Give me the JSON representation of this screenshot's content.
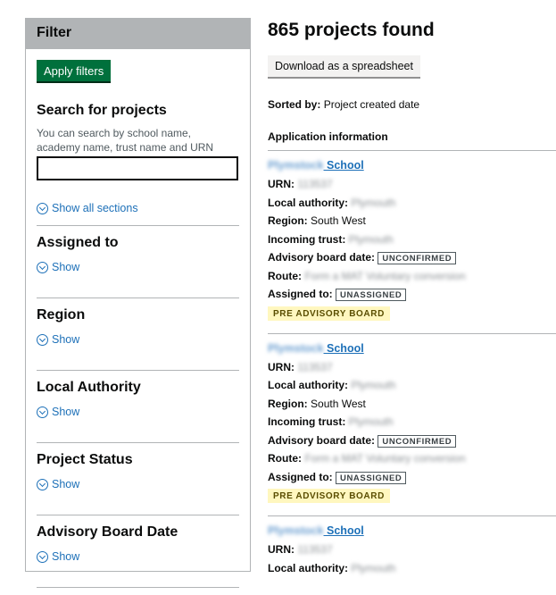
{
  "filter": {
    "header": "Filter",
    "apply_label": "Apply filters",
    "search_title": "Search for projects",
    "search_hint": "You can search by school name, academy name, trust name and URN",
    "search_value": "",
    "show_all_label": "Show all sections",
    "sections": [
      {
        "title": "Assigned to",
        "show_label": "Show"
      },
      {
        "title": "Region",
        "show_label": "Show"
      },
      {
        "title": "Local Authority",
        "show_label": "Show"
      },
      {
        "title": "Project Status",
        "show_label": "Show"
      },
      {
        "title": "Advisory Board Date",
        "show_label": "Show"
      }
    ]
  },
  "results": {
    "title": "865 projects found",
    "download_label": "Download as a spreadsheet",
    "sorted_label": "Sorted by:",
    "sorted_value": "Project created date",
    "section_heading": "Application information",
    "labels": {
      "urn": "URN:",
      "local_authority": "Local authority:",
      "region": "Region:",
      "incoming_trust": "Incoming trust:",
      "advisory_board_date": "Advisory board date:",
      "route": "Route:",
      "assigned_to": "Assigned to:"
    },
    "projects": [
      {
        "name_blurred": "Plymstock",
        "name_suffix": "School",
        "urn": "113537",
        "local_authority": "Plymouth",
        "region": "South West",
        "incoming_trust": "Plymouth",
        "advisory_board_date": "UNCONFIRMED",
        "route": "Form a MAT Voluntary conversion",
        "assigned_to": "UNASSIGNED",
        "status": "PRE ADVISORY BOARD"
      },
      {
        "name_blurred": "Plymstock",
        "name_suffix": "School",
        "urn": "113537",
        "local_authority": "Plymouth",
        "region": "South West",
        "incoming_trust": "Plymouth",
        "advisory_board_date": "UNCONFIRMED",
        "route": "Form a MAT Voluntary conversion",
        "assigned_to": "UNASSIGNED",
        "status": "PRE ADVISORY BOARD"
      },
      {
        "name_blurred": "Plymstock",
        "name_suffix": "School",
        "urn": "113537",
        "local_authority": "Plymouth"
      }
    ]
  },
  "colors": {
    "link": "#1d70b8",
    "primary_button": "#00703c",
    "filter_header": "#b1b4b6",
    "status_tag_bg": "#fff7bf",
    "status_tag_text": "#594d00"
  },
  "icons": {
    "show_toggle": "chevron-circle-down-icon"
  }
}
